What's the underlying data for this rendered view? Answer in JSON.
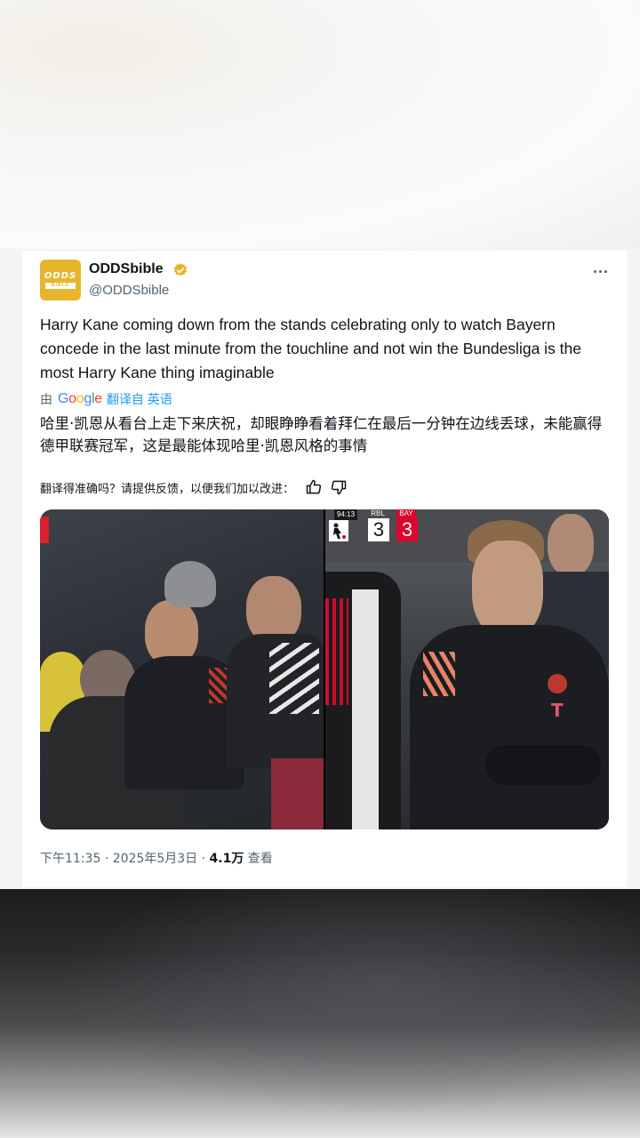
{
  "tweet": {
    "display_name": "ODDSbible",
    "handle": "@ODDSbible",
    "avatar_text_top": "ODDS",
    "avatar_text_bottom": "BIBLE",
    "text": "Harry Kane coming down from the stands celebrating only to watch Bayern concede in the last minute from the touchline and not win the Bundesliga is the most Harry Kane thing imaginable",
    "translation": {
      "prefix": "由",
      "provider": "Google",
      "label": "翻译自 英语",
      "text": "哈里·凯恩从看台上走下来庆祝，却眼睁睁看着拜仁在最后一分钟在边线丢球，未能赢得德甲联赛冠军，这是最能体现哈里·凯恩风格的事情",
      "feedback_prompt": "翻译得准确吗？请提供反馈，以便我们加以改进："
    },
    "media": {
      "scoreboard": {
        "clock": "94:13",
        "home_team": "RBL",
        "away_team": "BAY",
        "home_score": "3",
        "away_score": "3"
      }
    },
    "meta": {
      "time": "下午11:35",
      "date": "2025年5月3日",
      "views_count": "4.1万",
      "views_label": "查看"
    }
  },
  "colors": {
    "text": "#0f1419",
    "secondary": "#536471",
    "link": "#1d9bf0",
    "verified": "#e7b52c",
    "bayern_red": "#dc052d"
  }
}
